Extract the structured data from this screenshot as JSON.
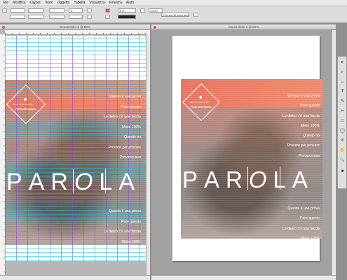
{
  "menu": [
    "File",
    "Modifica",
    "Layout",
    "Testo",
    "Oggetto",
    "Tabella",
    "Visualizza",
    "Finestra",
    "Aiuto"
  ],
  "control": {
    "field_a": "4 °",
    "field_b": "0 pt",
    "field_c": "100%",
    "field_d": "Cornice di testo auto"
  },
  "left_doc": {
    "title": "Senza titolo-1 @ 50%"
  },
  "right_doc": {
    "title": "Senza titolo-1 @ 50%"
  },
  "page": {
    "logo_top_line": "Sono un piccolo logo",
    "logo_bold": "Prova testo Ipsum",
    "list_top": [
      "Questa è una prova",
      "Pure questo",
      "Lo dietro c'è una faccia",
      "Miele 100%",
      "Questo no",
      "Provare per provare",
      "Provavovava"
    ],
    "word": [
      "P",
      "A",
      "R",
      "O",
      "L",
      "A"
    ],
    "list_bottom": [
      "Questa è una prova",
      "Pure questo",
      "Lo dietro c'è una faccia",
      "Miele 100%"
    ]
  },
  "tools": [
    "▸",
    "▹",
    "↔",
    "T",
    "✎",
    "✂",
    "□",
    "◯",
    "✕",
    "✋",
    "🔍",
    "■"
  ]
}
